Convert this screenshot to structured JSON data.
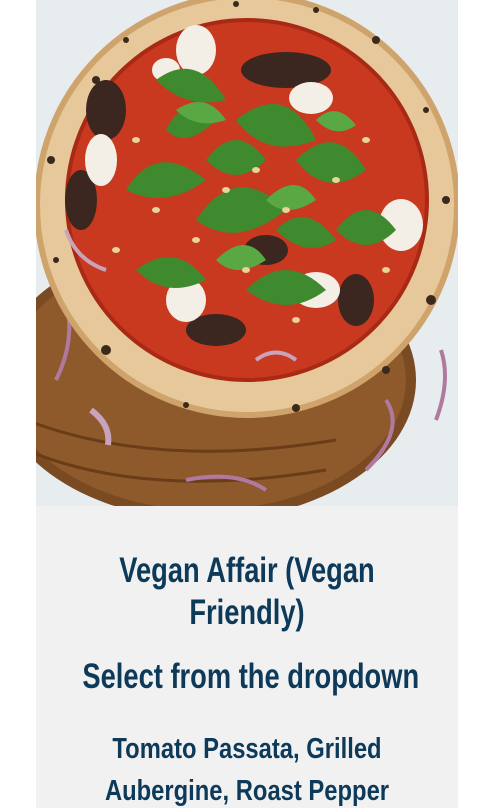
{
  "product": {
    "title": "Vegan Affair (Vegan Friendly)",
    "select_prompt": "Select from the dropdown",
    "ingredients": "Tomato Passata, Grilled Aubergine, Roast Pepper"
  },
  "colors": {
    "heading": "#0e3a5a",
    "card_background": "#f2f1f1"
  }
}
